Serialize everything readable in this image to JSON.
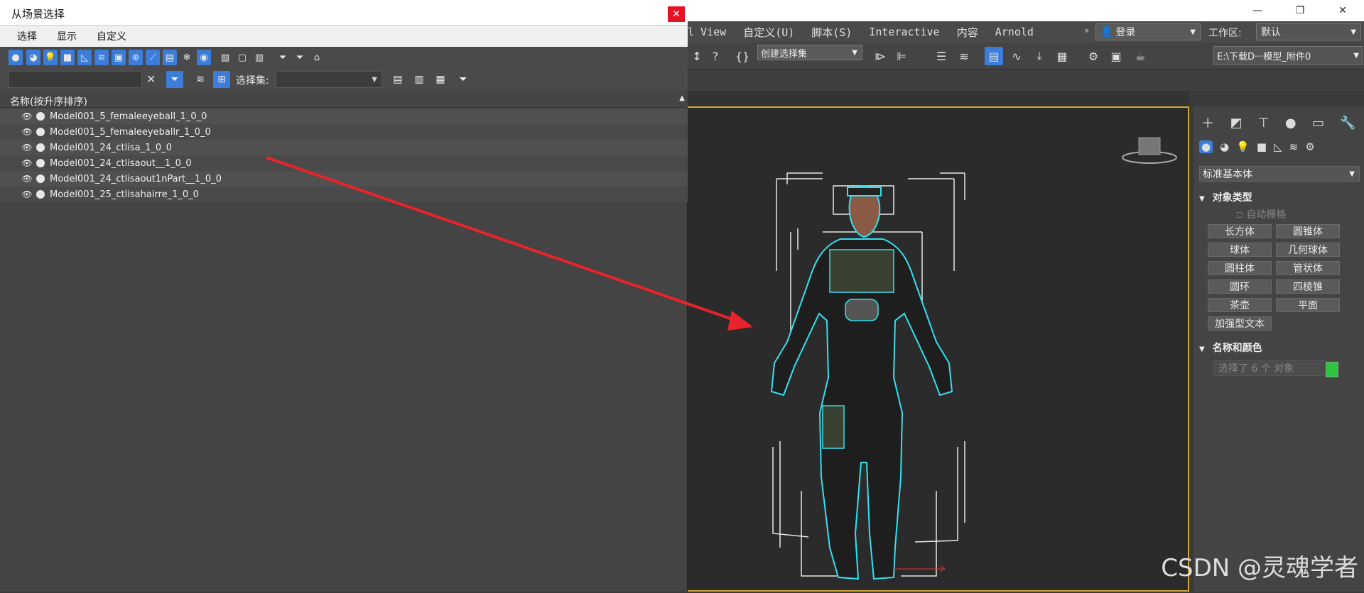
{
  "main_menu": {
    "items": [
      "l View",
      "自定义(U)",
      "脚本(S)",
      "Interactive",
      "内容",
      "Arnold"
    ],
    "login_label": "登录",
    "workspace_label": "工作区:",
    "workspace_value": "默认"
  },
  "main_toolbar": {
    "selection_set_placeholder": "创建选择集",
    "path_value": "E:\\下载D···模型_附件0"
  },
  "dialog": {
    "title": "从场景选择",
    "menu": [
      "选择",
      "显示",
      "自定义"
    ],
    "selection_set_label": "选择集:",
    "find_placeholder": "",
    "column_header": "名称(按升序排序)",
    "rows": [
      "Model001_5_femaleeyeball_1_0_0",
      "Model001_5_femaleeyeballr_1_0_0",
      "Model001_24_ctlisa_1_0_0",
      "Model001_24_ctlisaout__1_0_0",
      "Model001_24_ctlisaout1nPart__1_0_0",
      "Model001_25_ctlisahairre_1_0_0"
    ]
  },
  "right_panel": {
    "dropdown": "标准基本体",
    "section_object_type": "对象类型",
    "auto_grid": "自动栅格",
    "buttons": [
      "长方体",
      "圆锥体",
      "球体",
      "几何球体",
      "圆柱体",
      "管状体",
      "圆环",
      "四棱锥",
      "茶壶",
      "平面",
      "加强型文本"
    ],
    "section_name_color": "名称和颜色",
    "name_field": "选择了 6 个 对象",
    "swatch_color": "#2bc43c"
  },
  "watermark": "CSDN @灵魂学者",
  "annotation_color": "#e8232a"
}
